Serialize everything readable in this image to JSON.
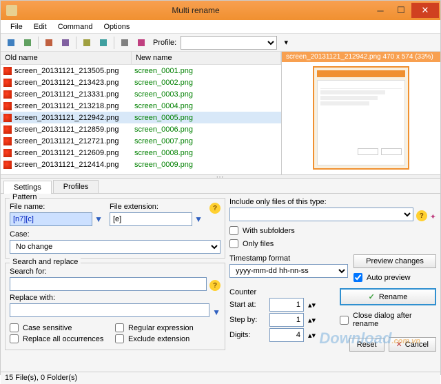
{
  "window": {
    "title": "Multi rename"
  },
  "menu": {
    "file": "File",
    "edit": "Edit",
    "command": "Command",
    "options": "Options"
  },
  "toolbar": {
    "profile_label": "Profile:"
  },
  "columns": {
    "old": "Old name",
    "new": "New name"
  },
  "files": [
    {
      "old": "screen_20131121_213505.png",
      "new": "screen_0001.png"
    },
    {
      "old": "screen_20131121_213423.png",
      "new": "screen_0002.png"
    },
    {
      "old": "screen_20131121_213331.png",
      "new": "screen_0003.png"
    },
    {
      "old": "screen_20131121_213218.png",
      "new": "screen_0004.png"
    },
    {
      "old": "screen_20131121_212942.png",
      "new": "screen_0005.png",
      "selected": true
    },
    {
      "old": "screen_20131121_212859.png",
      "new": "screen_0006.png"
    },
    {
      "old": "screen_20131121_212721.png",
      "new": "screen_0007.png"
    },
    {
      "old": "screen_20131121_212609.png",
      "new": "screen_0008.png"
    },
    {
      "old": "screen_20131121_212414.png",
      "new": "screen_0009.png"
    }
  ],
  "preview": {
    "info": "screen_20131121_212942.png   470 x 574 (33%)"
  },
  "tabs": {
    "settings": "Settings",
    "profiles": "Profiles"
  },
  "pattern": {
    "group": "Pattern",
    "filename_label": "File name:",
    "filename_value": "[n7][c]",
    "ext_label": "File extension:",
    "ext_value": "[e]",
    "case_label": "Case:",
    "case_value": "No change"
  },
  "search": {
    "group": "Search and replace",
    "search_label": "Search for:",
    "replace_label": "Replace with:",
    "case_sensitive": "Case sensitive",
    "replace_all": "Replace all occurrences",
    "regex": "Regular expression",
    "exclude_ext": "Exclude extension"
  },
  "filter": {
    "label": "Include only files of this type:",
    "with_subfolders": "With subfolders",
    "only_files": "Only files"
  },
  "timestamp": {
    "label": "Timestamp format",
    "value": "yyyy-mm-dd hh-nn-ss"
  },
  "counter": {
    "label": "Counter",
    "start_label": "Start at:",
    "start_value": "1",
    "step_label": "Step by:",
    "step_value": "1",
    "digits_label": "Digits:",
    "digits_value": "4"
  },
  "buttons": {
    "preview": "Preview changes",
    "auto_preview": "Auto preview",
    "rename": "Rename",
    "close_after": "Close dialog after rename",
    "reset": "Reset",
    "cancel": "Cancel"
  },
  "status": {
    "text": "15 File(s), 0 Folder(s)"
  }
}
